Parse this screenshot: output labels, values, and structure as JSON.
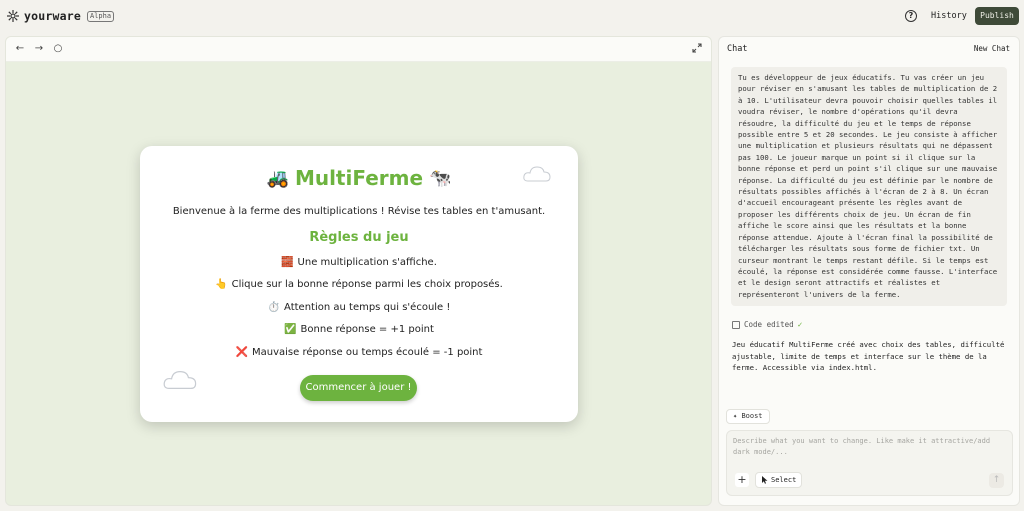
{
  "app": {
    "name": "yourware",
    "badge": "Alpha",
    "history_label": "History",
    "publish_label": "Publish",
    "help_label": "?"
  },
  "preview": {
    "nav": {
      "back": "←",
      "forward": "→",
      "reload": "○"
    },
    "game": {
      "title": "MultiFerme",
      "title_emoji_left": "🚜",
      "title_emoji_right": "🐄",
      "welcome": "Bienvenue à la ferme des multiplications ! Révise tes tables en t'amusant.",
      "rules_title": "Règles du jeu",
      "rules": [
        {
          "icon": "🧱",
          "text": "Une multiplication s'affiche."
        },
        {
          "icon": "👆",
          "text": "Clique sur la bonne réponse parmi les choix proposés."
        },
        {
          "icon": "⏱️",
          "text": "Attention au temps qui s'écoule !"
        },
        {
          "icon": "✅",
          "text": "Bonne réponse = +1 point"
        },
        {
          "icon": "❌",
          "text": "Mauvaise réponse ou temps écoulé = -1 point"
        }
      ],
      "start_button": "Commencer à jouer !"
    }
  },
  "chat": {
    "title": "Chat",
    "new_chat": "New Chat",
    "user_message": "Tu es développeur de jeux éducatifs. Tu vas créer un jeu pour réviser en s'amusant les tables de multiplication de 2 à 10. L'utilisateur devra pouvoir choisir quelles tables il voudra réviser, le nombre d'opérations qu'il devra résoudre, la difficulté du jeu et le temps de réponse possible entre 5 et 20 secondes. Le jeu consiste à afficher une multiplication et plusieurs résultats qui ne dépassent pas 100. Le joueur marque un point si il clique sur la bonne réponse et perd un point s'il clique sur une mauvaise réponse. La difficulté du jeu est définie par le nombre de résultats possibles affichés à l'écran de 2 à 8. Un écran d'accueil encourageant présente les règles avant de proposer les différents choix de jeu. Un écran de fin affiche le score ainsi que les résultats et la bonne réponse attendue. Ajoute à l'écran final la possibilité de télécharger les résultats sous forme de fichier txt. Un curseur montrant le temps restant défile. Si le temps est écoulé, la réponse est considérée comme fausse. L'interface et le design seront attractifs et réalistes et représenteront l'univers de la ferme.",
    "code_edited_label": "Code edited",
    "assistant_message": "Jeu éducatif MultiFerme créé avec choix des tables, difficulté ajustable, limite de temps et interface sur le thème de la ferme. Accessible via index.html.",
    "boost_label": "Boost",
    "input_placeholder": "Describe what you want to change. Like make it attractive/add dark mode/...",
    "select_label": "Select",
    "plus_label": "+",
    "send_label": "↑"
  },
  "colors": {
    "accent_green": "#6db33f",
    "publish_bg": "#3e4a38",
    "preview_bg": "#e9efdf"
  }
}
